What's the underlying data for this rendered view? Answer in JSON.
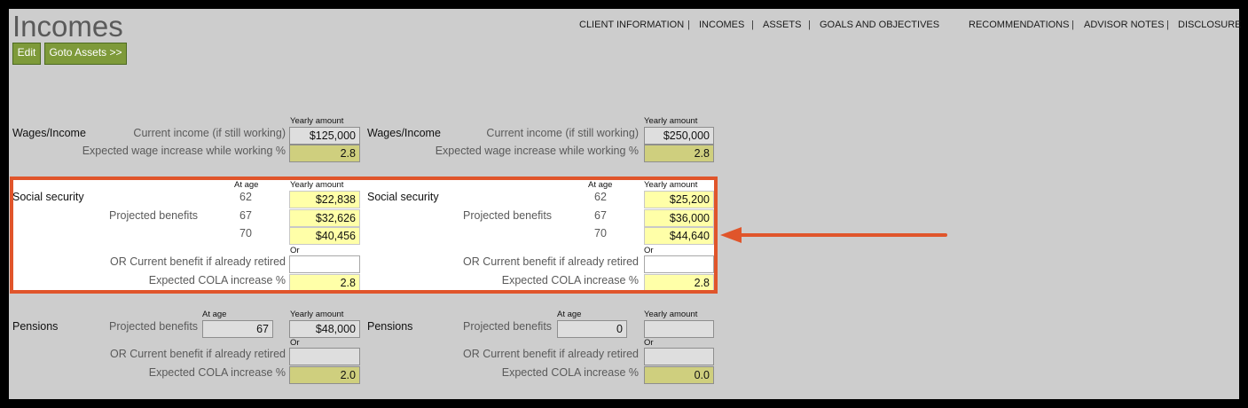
{
  "page": {
    "title": "Incomes"
  },
  "toolbar": {
    "edit_label": "Edit",
    "goto_assets_label": "Goto Assets >>"
  },
  "nav": {
    "items": [
      "CLIENT INFORMATION",
      "INCOMES",
      "ASSETS",
      "GOALS AND OBJECTIVES",
      "RECOMMENDATIONS",
      "ADVISOR NOTES",
      "DISCLOSURE"
    ],
    "separator": "|"
  },
  "labels": {
    "yearly_amount": "Yearly amount",
    "at_age": "At age",
    "or": "Or",
    "wages_section": "Wages/Income",
    "current_income": "Current income (if still working)",
    "wage_increase": "Expected wage increase while working %",
    "ss_section": "Social security",
    "projected_benefits": "Projected benefits",
    "or_current_benefit": "OR Current benefit if already retired",
    "cola": "Expected COLA increase %",
    "pensions_section": "Pensions"
  },
  "ss_ages": [
    "62",
    "67",
    "70"
  ],
  "left": {
    "wages": {
      "current_income": "$125,000",
      "wage_increase": "2.8"
    },
    "ss": {
      "benefits": [
        "$22,838",
        "$32,626",
        "$40,456"
      ],
      "current_benefit": "",
      "cola": "2.8"
    },
    "pension": {
      "age": "67",
      "amount": "$48,000",
      "current_benefit": "",
      "cola": "2.0"
    }
  },
  "right": {
    "wages": {
      "current_income": "$250,000",
      "wage_increase": "2.8"
    },
    "ss": {
      "benefits": [
        "$25,200",
        "$36,000",
        "$44,640"
      ],
      "current_benefit": "",
      "cola": "2.8"
    },
    "pension": {
      "age": "0",
      "amount": "",
      "current_benefit": "",
      "cola": "0.0"
    }
  },
  "annotation": {
    "highlight_color": "#e0552b"
  }
}
